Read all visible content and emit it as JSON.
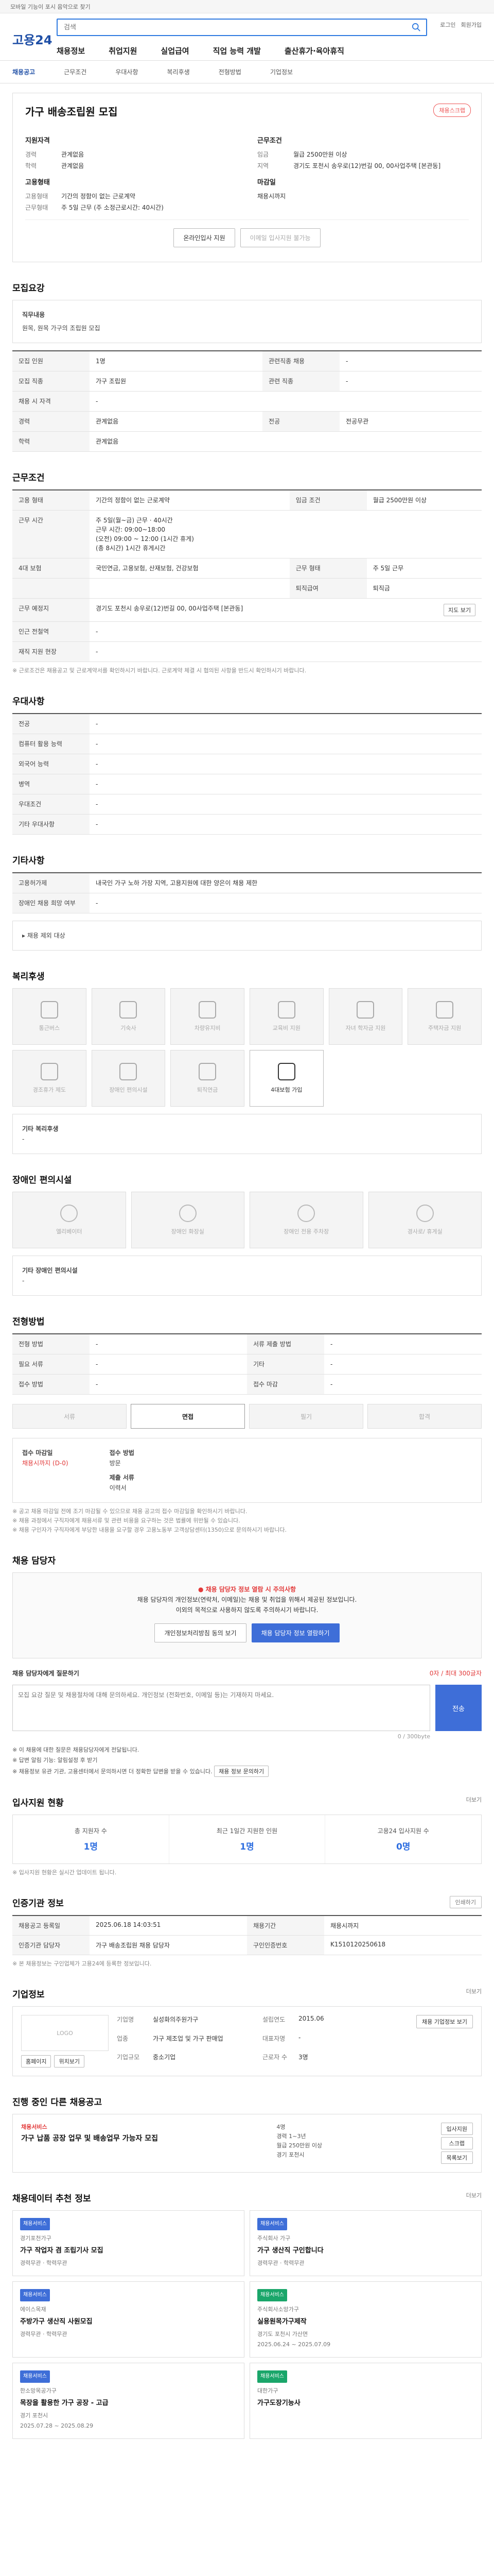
{
  "topbar": {
    "text": "모바일 기능이 포시 음악으로 찾기"
  },
  "header": {
    "logo": "고용24",
    "search_placeholder": "검색",
    "util": [
      "로그인",
      "회원가입"
    ],
    "gnb": [
      "채용정보",
      "취업지원",
      "실업급여",
      "직업 능력 개발",
      "출산휴가·육아휴직"
    ]
  },
  "subnav": {
    "items": [
      "채용공고",
      "근무조건",
      "우대사항",
      "복리후생",
      "전형방법",
      "기업정보"
    ],
    "active_index": 0
  },
  "title": {
    "name": "가구 배송조립원 모집",
    "scrap": "채용스크랩",
    "apply_label": "지원자격",
    "apply_rows": [
      {
        "k": "경력",
        "v": "관계없음"
      },
      {
        "k": "학력",
        "v": "관계없음"
      }
    ],
    "work_label": "근무조건",
    "work_rows": [
      {
        "k": "임금",
        "v": "월급 2500만원 이상"
      },
      {
        "k": "지역",
        "v": "경기도 포천시 송우로(12)번길 00, 00사업주택 [본관동]"
      }
    ],
    "emp_label": "고용형태",
    "emp_rows": [
      {
        "k": "고용형태",
        "v": "기간의 정함이 없는 근로계약"
      },
      {
        "k": "근무형태",
        "v": "주 5일 근무 (주 소정근로시간: 40시간)"
      }
    ],
    "deadline_label": "마감일",
    "deadline_value": "채용시까지",
    "btn_apply": "온라인입사 지원",
    "btn_interest": "이메일 입사지원 불가능"
  },
  "recruit": {
    "heading": "모집요강",
    "job_desc_title": "직무내용",
    "job_desc_text": "원목, 원목 가구의 조립원 모집",
    "rows": [
      {
        "k": "모집 인원",
        "v": "1명"
      },
      {
        "k": "모집 직종",
        "v": "가구 조립원"
      },
      {
        "k": "채용 시 자격",
        "v": "-"
      },
      {
        "k": "경력",
        "v": "관계없음"
      },
      {
        "k": "학력",
        "v": "관계없음"
      }
    ],
    "rows_right": [
      {
        "k": "관련직종 채용",
        "v": "-"
      },
      {
        "k": "관련 직종",
        "v": "-"
      },
      {
        "k": "",
        "v": ""
      },
      {
        "k": "전공",
        "v": "전공무관"
      },
      {
        "k": "",
        "v": ""
      }
    ]
  },
  "condition": {
    "heading": "근무조건",
    "rows": [
      {
        "k": "고용 형태",
        "v": "기간의 정함이 없는 근로계약"
      },
      {
        "k": "근무 시간",
        "v": "주 5일(월~금) 근무 · 40시간\n근무 시간: 09:00~18:00\n(오전) 09:00 ~ 12:00 (1시간 휴게)\n(총 8시간) 1시간 휴게시간"
      },
      {
        "k": "4대 보험",
        "v": "국민연금, 고용보험, 산재보험, 건강보험"
      },
      {
        "k": "근무 예정지",
        "v": "경기도 포천시 송우로(12)번길 00, 00사업주택 [본관동]"
      },
      {
        "k": "인근 전철역",
        "v": "-"
      },
      {
        "k": "재직 지원 현장",
        "v": "-"
      }
    ],
    "right": [
      {
        "k": "임금 조건",
        "v": "월급 2500만원 이상"
      },
      {
        "k": "근무 형태",
        "v": "주 5일 근무"
      },
      {
        "k": "퇴직급여",
        "v": "퇴직금"
      }
    ],
    "map_btn": "지도 보기",
    "note": "※ 근로조건은 채용공고 및 근로계약서를 확인하시기 바랍니다. 근로계약 체결 시 협의된 사항을 반드시 확인하시기 바랍니다."
  },
  "pref": {
    "heading": "우대사항",
    "rows": [
      {
        "k": "전공",
        "v": "-"
      },
      {
        "k": "컴퓨터 활용 능력",
        "v": "-"
      },
      {
        "k": "외국어 능력",
        "v": "-"
      },
      {
        "k": "병역",
        "v": "-"
      },
      {
        "k": "우대조건",
        "v": "-"
      },
      {
        "k": "기타 우대사항",
        "v": "-"
      }
    ]
  },
  "etc": {
    "heading": "기타사항",
    "rows": [
      {
        "k": "고용허가제",
        "v": "내국인 가구 노하 가장 지역, 고용지원에 대한 양은이 채용 제한"
      },
      {
        "k": "장애인 채용 희망 여부",
        "v": "-"
      }
    ],
    "link": "채용 제외 대상"
  },
  "welfare": {
    "heading": "복리후생",
    "items": [
      {
        "label": "통근버스",
        "on": false
      },
      {
        "label": "기숙사",
        "on": false
      },
      {
        "label": "차량유지비",
        "on": false
      },
      {
        "label": "교육비 지원",
        "on": false
      },
      {
        "label": "자녀 학자금 지원",
        "on": false
      },
      {
        "label": "주택자금 지원",
        "on": false
      },
      {
        "label": "경조휴가 제도",
        "on": false
      },
      {
        "label": "장애인 편의시설",
        "on": false
      },
      {
        "label": "퇴직연금",
        "on": false
      },
      {
        "label": "4대보험 가입",
        "on": true
      }
    ],
    "etc_label": "기타 복리후생",
    "etc_value": "-"
  },
  "disability": {
    "heading": "장애인 편의시설",
    "items": [
      "엘리베이터",
      "장애인 화장실",
      "장애인 전용 주차장",
      "경사로/ 휴게실"
    ],
    "etc_label": "기타 장애인 편의시설",
    "etc_value": "-"
  },
  "hiring": {
    "heading": "전형방법",
    "rows_left": [
      {
        "k": "전형 방법",
        "v": "-"
      },
      {
        "k": "필요 서류",
        "v": "-"
      },
      {
        "k": "접수 방법",
        "v": "-"
      }
    ],
    "rows_right": [
      {
        "k": "서류 제출 방법",
        "v": "-"
      },
      {
        "k": "기타",
        "v": "-"
      },
      {
        "k": "접수 마감",
        "v": "-"
      }
    ],
    "steps": [
      "서류",
      "면접",
      "필기",
      "합격"
    ],
    "active_step": 1,
    "deadline_label": "접수 마감일",
    "deadline_value": "채용시까지 (D-0)",
    "method_label": "접수 방법",
    "method_value": "방문",
    "apply_way_label": "제출 서류",
    "apply_way_value": "이력서",
    "notes": [
      "※ 공고 채용 마감일 전에 조기 마감될 수 있으므로 채용 공고의 접수 마감일을 확인하시기 바랍니다.",
      "※ 채용 과정에서 구직자에게 채용서류 및 관련 비용을 요구하는 것은 법률에 위반될 수 있습니다.",
      "※ 채용 구인자가 구직자에게 부당한 내용을 요구할 경우 고용노동부 고객상담센터(1350)으로 문의하시기 바랍니다."
    ]
  },
  "contact": {
    "heading": "채용 담당자",
    "warn": "채용 담당자 정보 열람 시 주의사항",
    "lines": [
      "채용 담당자의 개인정보(연락처, 이메일)는 채용 및 취업을 위해서 제공된 정보입니다.",
      "이외의 목적으로 사용하지 않도록 주의하시기 바랍니다."
    ],
    "btn_agree": "개인정보처리방침 동의 보기",
    "btn_view": "채용 담당자 정보 열람하기",
    "qna_label": "채용 담당자에게 질문하기",
    "qna_hint": "0자 / 최대 300글자",
    "qna_placeholder": "모집 요강 질문 및 채용절차에 대해 문의하세요. 개인정보 (전화번호, 이메일 등)는 기재하지 마세요.",
    "qna_send": "전송",
    "qna_count": "0 / 300byte",
    "checks": [
      "※ 이 채용에 대한 질문은 채용담당자에게 전달됩니다.",
      "※ 답변 알림 기능: 알림설정 후 받기",
      "※ 채용정보 유관 기관, 고용센터에서 문의하시면 더 정확한 답변을 받을 수 있습니다."
    ],
    "check_btn": "채용 정보 문의하기"
  },
  "stats": {
    "heading": "입사지원 현황",
    "more": "더보기",
    "items": [
      {
        "label": "총 지원자 수",
        "value": "1명"
      },
      {
        "label": "최근 1일간 지원한 인원",
        "value": "1명"
      },
      {
        "label": "고용24 입사지원 수",
        "value": "0명"
      }
    ],
    "note": "※ 입사지원 현황은 실시간 업데이트 됩니다."
  },
  "manage": {
    "heading": "인증기관 정보",
    "btn_print": "인쇄하기",
    "rows": [
      [
        "채용공고 등록일",
        "2025.06.18 14:03:51",
        "채용기간",
        "채용시까지"
      ],
      [
        "인증기관 담당자",
        "가구 배송조립원 채용 담당자",
        "구인인증번호",
        "K1510120250618"
      ]
    ],
    "note": "※ 본 채용정보는 구인업체가 고용24에 등록한 정보입니다."
  },
  "company": {
    "heading": "기업정보",
    "more": "더보기",
    "logo_text": "LOGO",
    "btn_home": "홈페이지",
    "btn_map": "위치보기",
    "rows": [
      {
        "k": "기업명",
        "v": "실성화의주원가구"
      },
      {
        "k": "업종",
        "v": "가구 제조업 및 가구 판매업"
      },
      {
        "k": "기업규모",
        "v": "중소기업"
      }
    ],
    "rows_right": [
      {
        "k": "설립연도",
        "v": "2015.06"
      },
      {
        "k": "대표자명",
        "v": "-"
      },
      {
        "k": "근로자 수",
        "v": "3명"
      }
    ],
    "detail_btn": "채용 기업정보 보기"
  },
  "other": {
    "heading": "진행 중인 다른 채용공고",
    "tag": "채용서비스",
    "title": "가구 납품 공장 업무 및 배송업무 가능자 모집",
    "meta": [
      "4명",
      "경력 1~3년",
      "월급 250만원 이상",
      "경기 포천시"
    ],
    "btns": [
      "입사지원",
      "스크랩",
      "목록보기"
    ]
  },
  "recommend": {
    "heading": "채용데이터 추천 정보",
    "more": "더보기",
    "items": [
      {
        "tag": "채용서비스",
        "company": "경기포천가구",
        "title": "가구 작업자 겸 조립기사 모집",
        "m1": "경력무관",
        "m2": "학력무관"
      },
      {
        "tag": "채용서비스",
        "company": "주식회사 가구",
        "title": "가구 생산직 구인합니다",
        "m1": "경력무관",
        "m2": "학력무관"
      },
      {
        "tag": "채용서비스",
        "company": "에이스목재",
        "title": "주방가구 생산직 사원모집",
        "m1": "경력무관",
        "m2": "학력무관"
      },
      {
        "tag": "채용서비스",
        "company": "주식회사소망가구",
        "title": "실용원목가구제작",
        "m1": "경기도 포천시 가산면",
        "m2": "2025.06.24 ~ 2025.07.09"
      },
      {
        "tag": "채용서비스",
        "company": "한소망목공가구",
        "title": "목장을 활용한 가구 공장 - 고급",
        "m1": "경기 포천시",
        "m2": "2025.07.28 ~ 2025.08.29"
      },
      {
        "tag": "채용서비스",
        "company": "대한가구",
        "title": "가구도장기능사",
        "m1": "",
        "m2": ""
      }
    ]
  }
}
